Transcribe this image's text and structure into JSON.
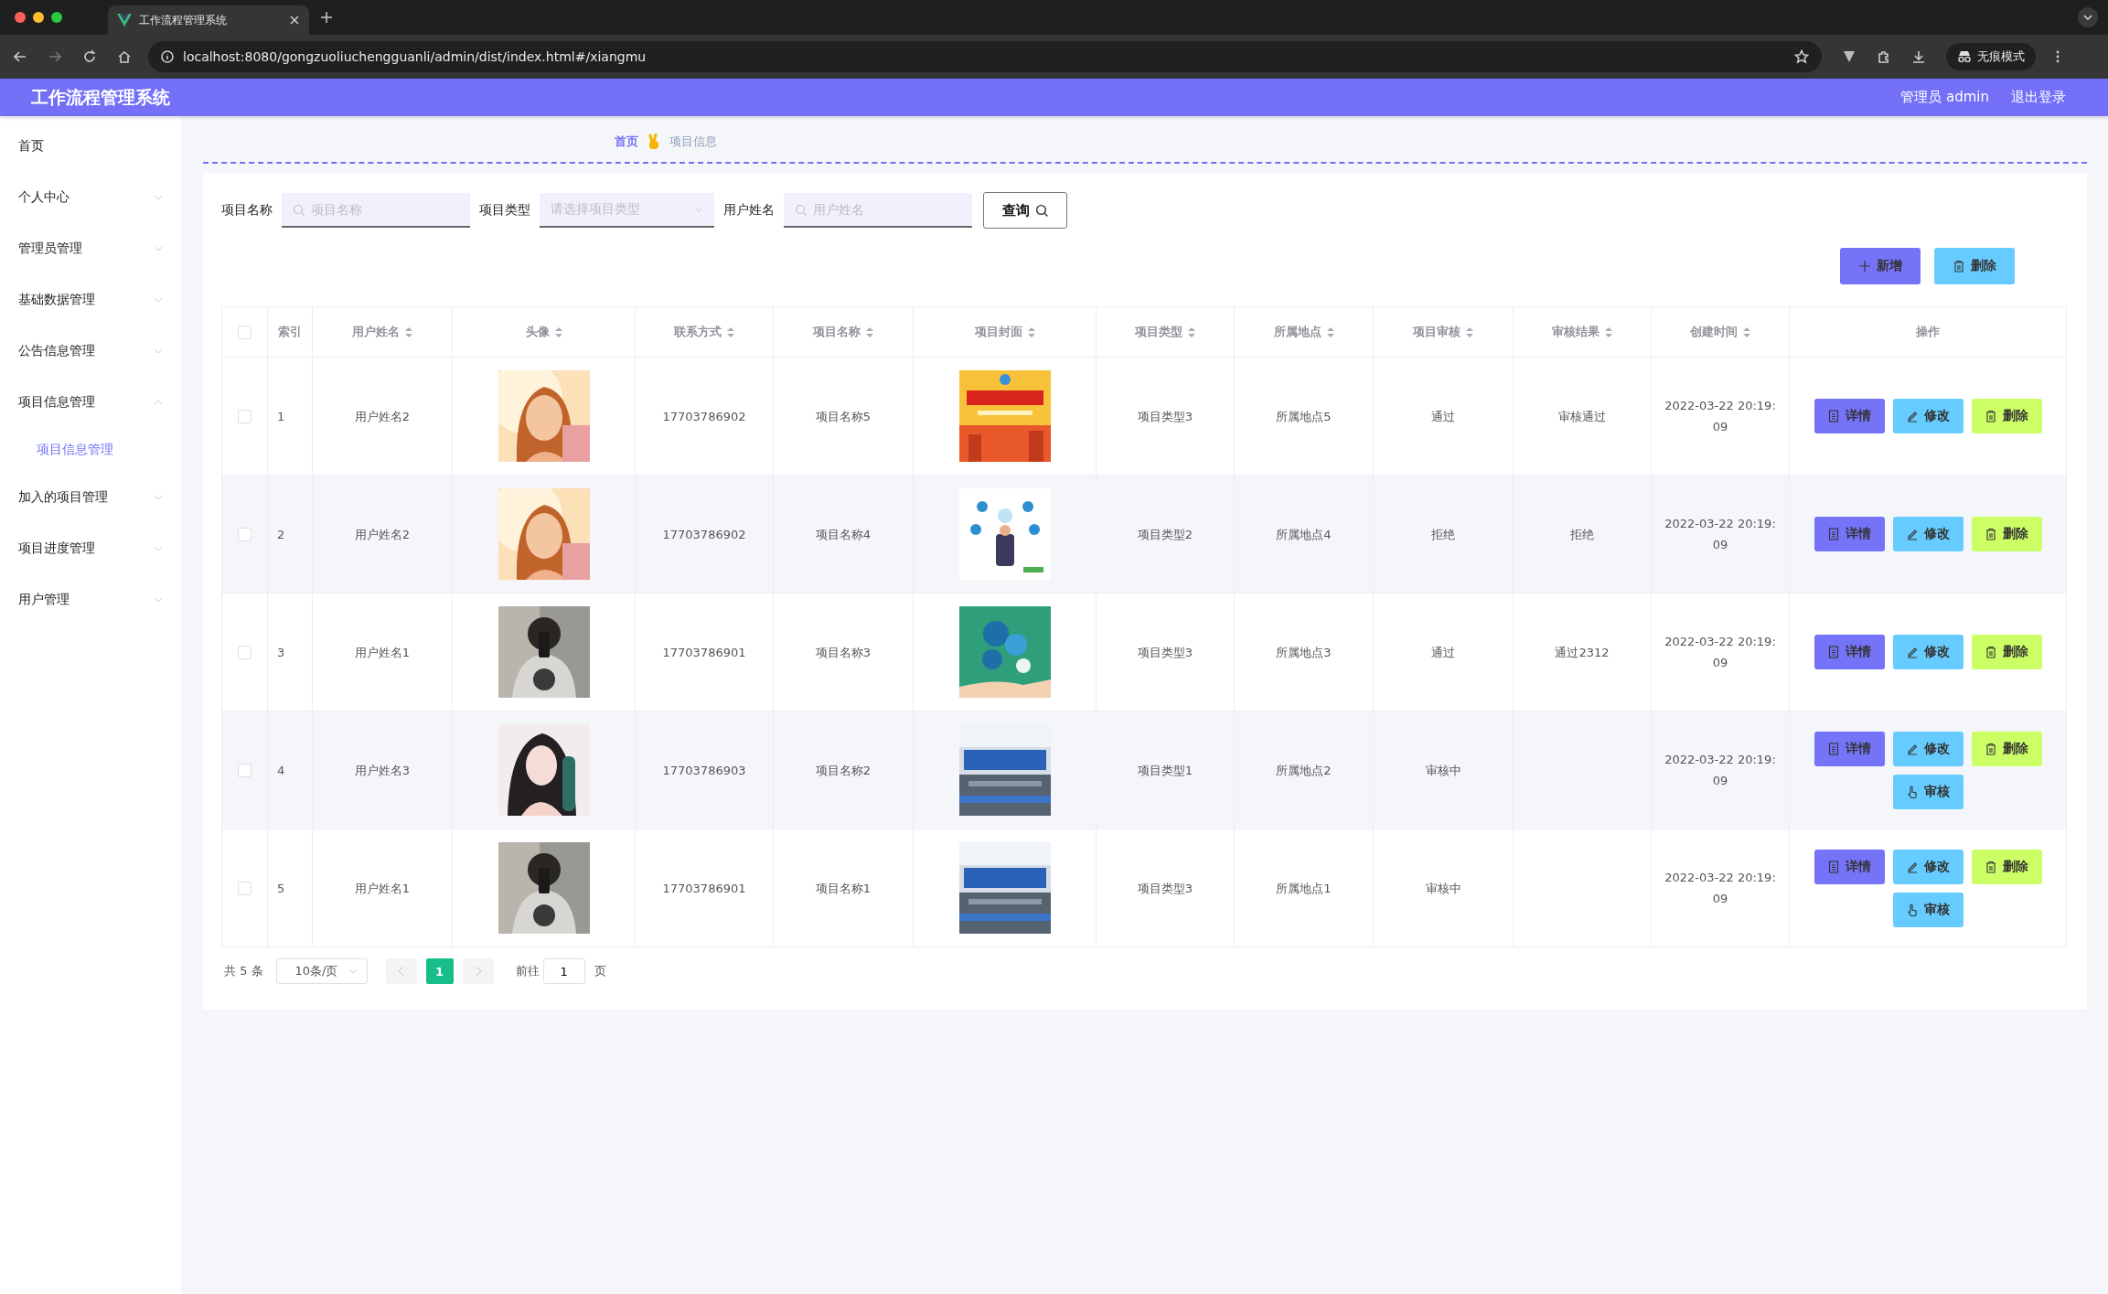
{
  "browser": {
    "tab_title": "工作流程管理系统",
    "url": "localhost:8080/gongzuoliuchengguanli/admin/dist/index.html#/xiangmu",
    "incognito_label": "无痕模式"
  },
  "header": {
    "title": "工作流程管理系统",
    "user": "管理员 admin",
    "logout": "退出登录"
  },
  "sidebar": {
    "items": [
      {
        "label": "首页"
      },
      {
        "label": "个人中心",
        "expanded": false
      },
      {
        "label": "管理员管理",
        "expanded": false
      },
      {
        "label": "基础数据管理",
        "expanded": false
      },
      {
        "label": "公告信息管理",
        "expanded": false
      },
      {
        "label": "项目信息管理",
        "expanded": true,
        "children": [
          {
            "label": "项目信息管理",
            "selected": true
          }
        ]
      },
      {
        "label": "加入的项目管理",
        "expanded": false
      },
      {
        "label": "项目进度管理",
        "expanded": false
      },
      {
        "label": "用户管理",
        "expanded": false
      }
    ]
  },
  "breadcrumb": [
    "首页",
    "项目信息"
  ],
  "filters": [
    {
      "kind": "input",
      "label": "项目名称",
      "placeholder": "项目名称"
    },
    {
      "kind": "select",
      "label": "项目类型",
      "placeholder": "请选择项目类型"
    },
    {
      "kind": "input",
      "label": "用户姓名",
      "placeholder": "用户姓名"
    }
  ],
  "query_button": "查询",
  "toolbar": [
    {
      "kind": "add",
      "label": "新增"
    },
    {
      "kind": "delete",
      "label": "删除"
    }
  ],
  "table": {
    "select_all_checked": false,
    "columns": [
      {
        "label": "索引",
        "sortable": false
      },
      {
        "label": "用户姓名",
        "sortable": true
      },
      {
        "label": "头像",
        "sortable": true
      },
      {
        "label": "联系方式",
        "sortable": true
      },
      {
        "label": "项目名称",
        "sortable": true
      },
      {
        "label": "项目封面",
        "sortable": true
      },
      {
        "label": "项目类型",
        "sortable": true
      },
      {
        "label": "所属地点",
        "sortable": true
      },
      {
        "label": "项目审核",
        "sortable": true
      },
      {
        "label": "审核结果",
        "sortable": true
      },
      {
        "label": "创建时间",
        "sortable": true
      },
      {
        "label": "操作",
        "sortable": false
      }
    ],
    "rows": [
      {
        "checked": false,
        "index": "1",
        "user": "用户姓名2",
        "avatar": {
          "kind": "picture"
        },
        "phone": "17703786902",
        "project": "项目名称5",
        "cover": {
          "kind": "picture"
        },
        "type": "项目类型3",
        "place": "所属地点5",
        "review": "通过",
        "result": "审核通过",
        "created": "2022-03-22 20:19:09",
        "actions": [
          {
            "kind": "detail",
            "label": "详情"
          },
          {
            "kind": "edit",
            "label": "修改"
          },
          {
            "kind": "delete",
            "label": "删除"
          }
        ]
      },
      {
        "checked": false,
        "index": "2",
        "user": "用户姓名2",
        "avatar": {
          "kind": "picture"
        },
        "phone": "17703786902",
        "project": "项目名称4",
        "cover": {
          "kind": "picture"
        },
        "type": "项目类型2",
        "place": "所属地点4",
        "review": "拒绝",
        "result": "拒绝",
        "created": "2022-03-22 20:19:09",
        "actions": [
          {
            "kind": "detail",
            "label": "详情"
          },
          {
            "kind": "edit",
            "label": "修改"
          },
          {
            "kind": "delete",
            "label": "删除"
          }
        ]
      },
      {
        "checked": false,
        "index": "3",
        "user": "用户姓名1",
        "avatar": {
          "kind": "picture"
        },
        "phone": "17703786901",
        "project": "项目名称3",
        "cover": {
          "kind": "picture"
        },
        "type": "项目类型3",
        "place": "所属地点3",
        "review": "通过",
        "result": "通过2312",
        "created": "2022-03-22 20:19:09",
        "actions": [
          {
            "kind": "detail",
            "label": "详情"
          },
          {
            "kind": "edit",
            "label": "修改"
          },
          {
            "kind": "delete",
            "label": "删除"
          }
        ]
      },
      {
        "checked": false,
        "index": "4",
        "user": "用户姓名3",
        "avatar": {
          "kind": "picture"
        },
        "phone": "17703786903",
        "project": "项目名称2",
        "cover": {
          "kind": "picture"
        },
        "type": "项目类型1",
        "place": "所属地点2",
        "review": "审核中",
        "created": "2022-03-22 20:19:09",
        "actions": [
          {
            "kind": "detail",
            "label": "详情"
          },
          {
            "kind": "edit",
            "label": "修改"
          },
          {
            "kind": "delete",
            "label": "删除"
          },
          {
            "kind": "review",
            "label": "审核"
          }
        ]
      },
      {
        "checked": false,
        "index": "5",
        "user": "用户姓名1",
        "avatar": {
          "kind": "picture"
        },
        "phone": "17703786901",
        "project": "项目名称1",
        "cover": {
          "kind": "picture"
        },
        "type": "项目类型3",
        "place": "所属地点1",
        "review": "审核中",
        "created": "2022-03-22 20:19:09",
        "actions": [
          {
            "kind": "detail",
            "label": "详情"
          },
          {
            "kind": "edit",
            "label": "修改"
          },
          {
            "kind": "delete",
            "label": "删除"
          },
          {
            "kind": "review",
            "label": "审核"
          }
        ]
      }
    ]
  },
  "pagination": {
    "total": "共 5 条",
    "page_size": "10条/页",
    "pages": [
      {
        "label": "1",
        "selected": true
      }
    ],
    "goto": "前往",
    "goto_value": "1",
    "goto_suffix": "页"
  }
}
